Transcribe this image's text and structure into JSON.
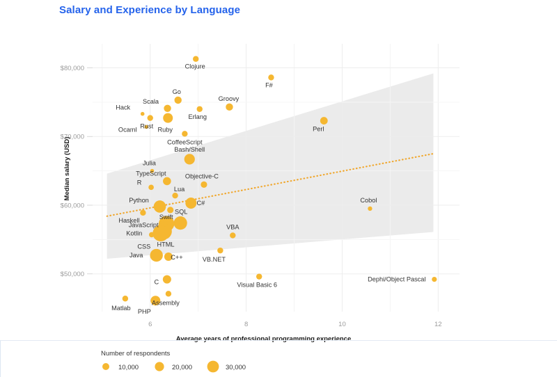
{
  "header": {
    "title": "Salary and Experience by Language",
    "title_color": "#2563eb"
  },
  "colors": {
    "point": "#f5b731",
    "trend_line": "#f0a830",
    "confidence_band": "#ebebeb",
    "grid": "#ededed",
    "tick_text": "#9b9b9b",
    "label_text": "#333333"
  },
  "legend": {
    "title": "Number of respondents",
    "items": [
      {
        "label": "10,000",
        "size": 10000,
        "radius": 5.0
      },
      {
        "label": "20,000",
        "size": 20000,
        "radius": 6.6
      },
      {
        "label": "30,000",
        "size": 30000,
        "radius": 8.4
      }
    ]
  },
  "chart_data": {
    "type": "scatter",
    "title": "Salary and Experience by Language",
    "xlabel": "Average years of professional programming experience",
    "ylabel": "Median salary (USD)",
    "xlim": [
      4.8,
      12.3
    ],
    "ylim": [
      44500,
      83500
    ],
    "xticks": [
      6,
      8,
      10,
      12
    ],
    "xtick_labels": [
      "6",
      "8",
      "10",
      "12"
    ],
    "yticks": [
      50000,
      60000,
      70000,
      80000
    ],
    "ytick_labels": [
      "$50,000",
      "$60,000",
      "$70,000",
      "$80,000"
    ],
    "grid": true,
    "legend_position": "bottom-left",
    "size_legend_title": "Number of respondents",
    "bubble_size_field": "respondents",
    "trend_line": {
      "style": "dotted",
      "x_start": 5.1,
      "y_start": 58400,
      "x_end": 11.9,
      "y_end": 67500
    },
    "confidence_band": {
      "x_start": 5.1,
      "x_end": 11.9,
      "upper_start": 64600,
      "lower_start": 52200,
      "upper_end": 79200,
      "lower_end": 56100
    },
    "points": [
      {
        "label": "Clojure",
        "x": 6.95,
        "y": 81300,
        "r": 4.2,
        "label_dx": -1,
        "label_dy": 14
      },
      {
        "label": "F#",
        "x": 8.52,
        "y": 78600,
        "r": 4.2,
        "label_dx": -3,
        "label_dy": 14
      },
      {
        "label": "Go",
        "x": 6.58,
        "y": 75300,
        "r": 5.2,
        "label_dx": -2,
        "label_dy": -9
      },
      {
        "label": "Groovy",
        "x": 7.65,
        "y": 74300,
        "r": 5.2,
        "label_dx": -1,
        "label_dy": -9
      },
      {
        "label": "Scala",
        "x": 6.36,
        "y": 74100,
        "r": 5.2,
        "label_dx": -24,
        "label_dy": -7
      },
      {
        "label": "Erlang",
        "x": 7.03,
        "y": 74000,
        "r": 4.2,
        "label_dx": -3,
        "label_dy": 14
      },
      {
        "label": "Hack",
        "x": 5.84,
        "y": 73300,
        "r": 2.8,
        "label_dx": -28,
        "label_dy": -6
      },
      {
        "label": "Rust",
        "x": 6.0,
        "y": 72700,
        "r": 4.2,
        "label_dx": -5,
        "label_dy": 15
      },
      {
        "label": "Ruby",
        "x": 6.37,
        "y": 72700,
        "r": 7.0,
        "label_dx": -4,
        "label_dy": 20
      },
      {
        "label": "Perl",
        "x": 9.62,
        "y": 72300,
        "r": 5.4,
        "label_dx": -8,
        "label_dy": 15
      },
      {
        "label": "Ocaml",
        "x": 5.92,
        "y": 71400,
        "r": 2.8,
        "label_dx": -27,
        "label_dy": 7
      },
      {
        "label": "CoffeeScript",
        "x": 6.72,
        "y": 70400,
        "r": 4.2,
        "label_dx": 0,
        "label_dy": 15
      },
      {
        "label": "Bash/Shell",
        "x": 6.82,
        "y": 66700,
        "r": 7.6,
        "label_dx": 0,
        "label_dy": -11
      },
      {
        "label": "Julia",
        "x": 6.04,
        "y": 65000,
        "r": 2.8,
        "label_dx": -4,
        "label_dy": -8
      },
      {
        "label": "TypeScript",
        "x": 6.35,
        "y": 63500,
        "r": 5.8,
        "label_dx": -23,
        "label_dy": -8
      },
      {
        "label": "Objective-C",
        "x": 7.12,
        "y": 63000,
        "r": 4.6,
        "label_dx": -3,
        "label_dy": -9
      },
      {
        "label": "R",
        "x": 6.02,
        "y": 62600,
        "r": 3.8,
        "label_dx": -17,
        "label_dy": -4
      },
      {
        "label": "Lua",
        "x": 6.52,
        "y": 61400,
        "r": 4.2,
        "label_dx": 6,
        "label_dy": -6
      },
      {
        "label": "C#",
        "x": 6.85,
        "y": 60300,
        "r": 8.0,
        "label_dx": 14,
        "label_dy": 3
      },
      {
        "label": "Python",
        "x": 6.2,
        "y": 59800,
        "r": 8.8,
        "label_dx": -30,
        "label_dy": -6
      },
      {
        "label": "Swift",
        "x": 6.42,
        "y": 59300,
        "r": 4.6,
        "label_dx": -6,
        "label_dy": 13
      },
      {
        "label": "Cobol",
        "x": 10.58,
        "y": 59500,
        "r": 3.2,
        "label_dx": -2,
        "label_dy": -9
      },
      {
        "label": "Haskell",
        "x": 5.85,
        "y": 58900,
        "r": 4.2,
        "label_dx": -20,
        "label_dy": 14
      },
      {
        "label": "SQL",
        "x": 6.63,
        "y": 57400,
        "r": 9.6,
        "label_dx": 1,
        "label_dy": -13
      },
      {
        "label": "JavaScript",
        "x": 6.34,
        "y": 57300,
        "r": 11.2,
        "label_dx": -33,
        "label_dy": 5
      },
      {
        "label": "HTML",
        "x": 6.28,
        "y": 56200,
        "r": 11.8,
        "label_dx": 3,
        "label_dy": 22
      },
      {
        "label": "CSS",
        "x": 6.22,
        "y": 55900,
        "r": 11.6,
        "label_dx": -24,
        "label_dy": 22
      },
      {
        "label": "Kotlin",
        "x": 6.03,
        "y": 55700,
        "r": 3.8,
        "label_dx": -25,
        "label_dy": 1
      },
      {
        "label": "VBA",
        "x": 7.72,
        "y": 55600,
        "r": 4.2,
        "label_dx": 0,
        "label_dy": -9
      },
      {
        "label": "Java",
        "x": 6.13,
        "y": 52700,
        "r": 9.2,
        "label_dx": -29,
        "label_dy": 3
      },
      {
        "label": "C++",
        "x": 6.38,
        "y": 52500,
        "r": 6.0,
        "label_dx": 12,
        "label_dy": 4
      },
      {
        "label": "VB.NET",
        "x": 7.46,
        "y": 53400,
        "r": 4.2,
        "label_dx": -9,
        "label_dy": 16
      },
      {
        "label": "C",
        "x": 6.35,
        "y": 49200,
        "r": 6.0,
        "label_dx": -15,
        "label_dy": 7
      },
      {
        "label": "Visual Basic 6",
        "x": 8.27,
        "y": 49600,
        "r": 4.2,
        "label_dx": -3,
        "label_dy": 15
      },
      {
        "label": "Dephi/Object Pascal",
        "x": 11.92,
        "y": 49200,
        "r": 3.6,
        "label_dx": -54,
        "label_dy": 3
      },
      {
        "label": "Assembly",
        "x": 6.38,
        "y": 47100,
        "r": 4.2,
        "label_dx": -4,
        "label_dy": 16
      },
      {
        "label": "PHP",
        "x": 6.11,
        "y": 46100,
        "r": 7.0,
        "label_dx": -16,
        "label_dy": 19
      },
      {
        "label": "Matlab",
        "x": 5.48,
        "y": 46400,
        "r": 4.2,
        "label_dx": -6,
        "label_dy": 17
      }
    ]
  }
}
